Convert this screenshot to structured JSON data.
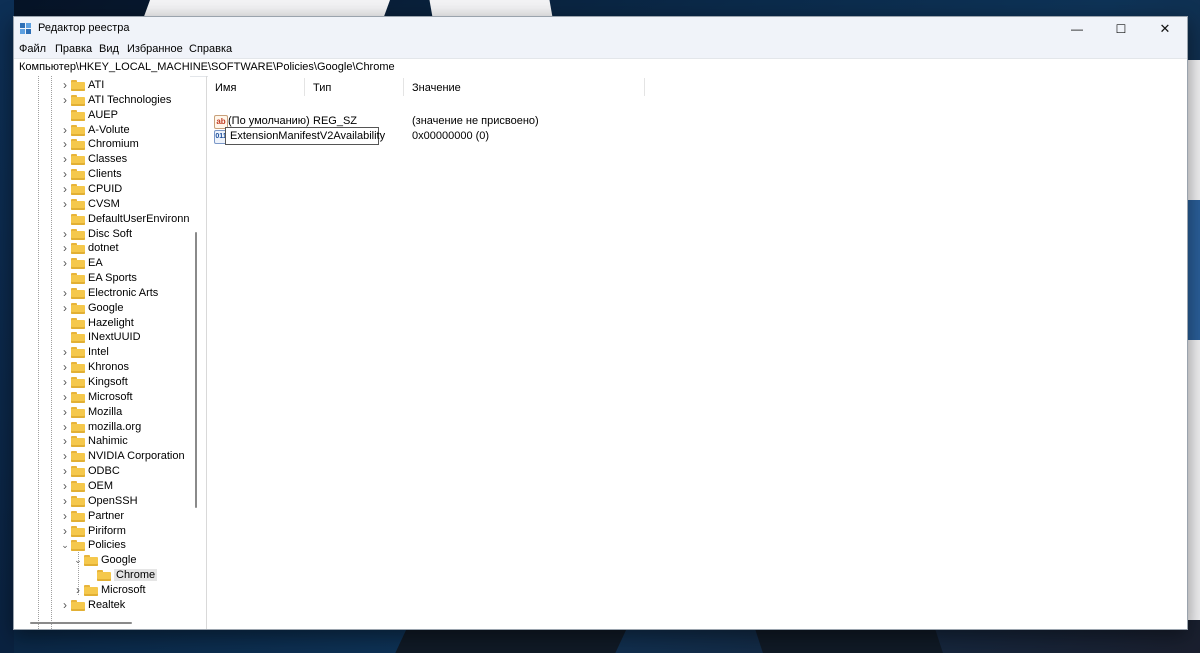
{
  "window": {
    "title": "Редактор реестра",
    "controls": {
      "minimize": "—",
      "maximize": "☐",
      "close": "✕"
    }
  },
  "menu": [
    "Файл",
    "Правка",
    "Вид",
    "Избранное",
    "Справка"
  ],
  "address": "Компьютер\\HKEY_LOCAL_MACHINE\\SOFTWARE\\Policies\\Google\\Chrome",
  "tree": {
    "items": [
      {
        "label": "ATI",
        "expander": ">"
      },
      {
        "label": "ATI Technologies",
        "expander": ">"
      },
      {
        "label": "AUEP",
        "expander": ""
      },
      {
        "label": "A-Volute",
        "expander": ">"
      },
      {
        "label": "Chromium",
        "expander": ">"
      },
      {
        "label": "Classes",
        "expander": ">"
      },
      {
        "label": "Clients",
        "expander": ">"
      },
      {
        "label": "CPUID",
        "expander": ">"
      },
      {
        "label": "CVSM",
        "expander": ">"
      },
      {
        "label": "DefaultUserEnvironn",
        "expander": ""
      },
      {
        "label": "Disc Soft",
        "expander": ">"
      },
      {
        "label": "dotnet",
        "expander": ">"
      },
      {
        "label": "EA",
        "expander": ">"
      },
      {
        "label": "EA Sports",
        "expander": ""
      },
      {
        "label": "Electronic Arts",
        "expander": ">"
      },
      {
        "label": "Google",
        "expander": ">"
      },
      {
        "label": "Hazelight",
        "expander": ""
      },
      {
        "label": "INextUUID",
        "expander": ""
      },
      {
        "label": "Intel",
        "expander": ">"
      },
      {
        "label": "Khronos",
        "expander": ">"
      },
      {
        "label": "Kingsoft",
        "expander": ">"
      },
      {
        "label": "Microsoft",
        "expander": ">"
      },
      {
        "label": "Mozilla",
        "expander": ">"
      },
      {
        "label": "mozilla.org",
        "expander": ">"
      },
      {
        "label": "Nahimic",
        "expander": ">"
      },
      {
        "label": "NVIDIA Corporation",
        "expander": ">"
      },
      {
        "label": "ODBC",
        "expander": ">"
      },
      {
        "label": "OEM",
        "expander": ">"
      },
      {
        "label": "OpenSSH",
        "expander": ">"
      },
      {
        "label": "Partner",
        "expander": ">"
      },
      {
        "label": "Piriform",
        "expander": ">"
      },
      {
        "label": "Policies",
        "expander": "v"
      },
      {
        "label": "Google",
        "expander": "v"
      },
      {
        "label": "Chrome",
        "expander": ""
      },
      {
        "label": "Microsoft",
        "expander": ">"
      },
      {
        "label": "Realtek",
        "expander": ">"
      }
    ]
  },
  "list": {
    "columns": {
      "name": "Имя",
      "type": "Тип",
      "value": "Значение"
    },
    "rows": [
      {
        "icon": "ab",
        "name": "(По умолчанию)",
        "type": "REG_SZ",
        "value": "(значение не присвоено)"
      },
      {
        "icon": "011",
        "name": "ExtensionManifestV2Availability",
        "type": "",
        "value": "0x00000000 (0)"
      }
    ]
  },
  "colors": {
    "folder": "#f5c84c",
    "titlebar": "#f0f3f9",
    "selection": "#e5e5e5"
  }
}
